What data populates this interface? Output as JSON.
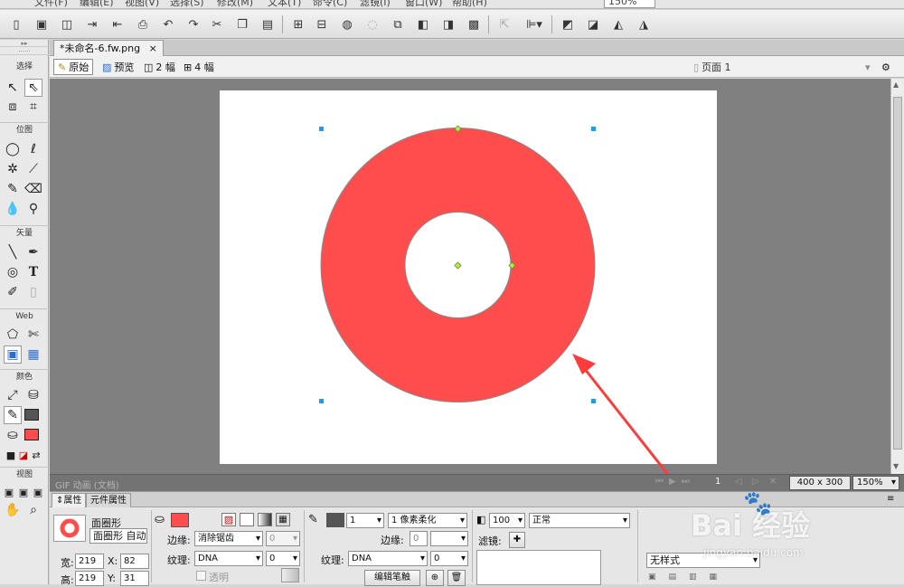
{
  "menu": {
    "items": [
      "文件(F)",
      "编辑(E)",
      "视图(V)",
      "选择(S)",
      "修改(M)",
      "文本(T)",
      "命令(C)",
      "滤镜(I)",
      "窗口(W)",
      "帮助(H)"
    ],
    "zoom_top": "150%"
  },
  "toolbar_icons": [
    "new-icon",
    "save-icon",
    "open-icon",
    "import-icon",
    "export-icon",
    "print-icon",
    "undo-icon",
    "redo-icon",
    "cut-icon",
    "copy-icon",
    "paste-icon",
    "group-icon",
    "ungroup-icon",
    "join-icon",
    "split-icon",
    "bring-front-icon",
    "bring-forward-icon",
    "send-backward-icon",
    "send-back-icon",
    "align-left-icon",
    "align-menu-icon",
    "rotate-left-icon",
    "rotate-right-icon",
    "flip-horizontal-icon",
    "flip-vertical-icon"
  ],
  "tools_panel": {
    "sections": [
      "选择",
      "位图",
      "矢量",
      "Web",
      "颜色",
      "视图"
    ],
    "stroke_color": "#555555",
    "fill_color": "#ff4d4d"
  },
  "document": {
    "tab_label": "*未命名-6.fw.png",
    "tab_close": "×",
    "view_buttons": [
      "原始",
      "预览",
      "2 幅",
      "4 幅"
    ],
    "page_label": "页面 1"
  },
  "canvas": {
    "background": "#ffffff",
    "shape_color": "#ff4d4d",
    "shape_stroke": "#8a8a8a"
  },
  "status": {
    "left_text": "GIF 动画 (文档)",
    "frame": "1",
    "size": "400 x 300",
    "zoom": "150%"
  },
  "properties": {
    "tabs": [
      "属性",
      "元件属性"
    ],
    "object_type": "面圈形",
    "object_name": "面圈形 自动",
    "width_label": "宽:",
    "width": "219",
    "height_label": "高:",
    "height": "219",
    "x_label": "X:",
    "x": "82",
    "y_label": "Y:",
    "y": "31",
    "fill": {
      "color": "#ff4d4d",
      "edge_label": "边缘:",
      "edge_value": "消除锯齿",
      "edge_amount": "0",
      "texture_label": "纹理:",
      "texture_value": "DNA",
      "texture_amount": "0",
      "transparent_label": "透明"
    },
    "stroke": {
      "color": "#555555",
      "size": "1",
      "type": "1 像素柔化",
      "edge_label": "边缘:",
      "edge_amount": "0",
      "texture_label": "纹理:",
      "texture_value": "DNA",
      "texture_amount": "0",
      "edit_stroke": "编辑笔触"
    },
    "opacity": "100",
    "blend_mode": "正常",
    "filters_label": "滤镜:",
    "style_value": "无样式"
  },
  "watermark": {
    "logo_text": "Bai 经验",
    "url": "jingyan.baidu.com"
  }
}
